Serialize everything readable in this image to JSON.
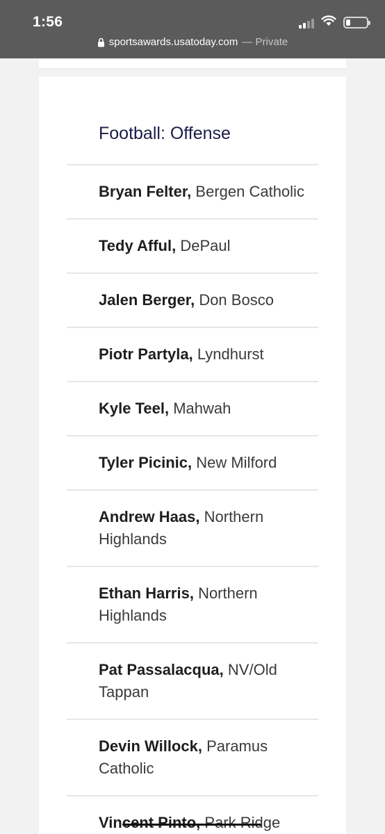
{
  "status_bar": {
    "time": "1:56"
  },
  "url_bar": {
    "domain": "sportsawards.usatoday.com",
    "suffix": "— Private"
  },
  "section": {
    "title": "Football: Offense"
  },
  "players": [
    {
      "name": "Bryan Felter,",
      "school": "Bergen Catholic"
    },
    {
      "name": "Tedy Afful,",
      "school": "DePaul"
    },
    {
      "name": "Jalen Berger,",
      "school": "Don Bosco"
    },
    {
      "name": "Piotr Partyla,",
      "school": "Lyndhurst"
    },
    {
      "name": "Kyle Teel,",
      "school": "Mahwah"
    },
    {
      "name": "Tyler Picinic,",
      "school": "New Milford"
    },
    {
      "name": "Andrew Haas,",
      "school": "Northern Highlands"
    },
    {
      "name": "Ethan Harris,",
      "school": "Northern Highlands"
    },
    {
      "name": "Pat Passalacqua,",
      "school": "NV/Old Tappan"
    },
    {
      "name": "Devin Willock,",
      "school": "Paramus Catholic"
    },
    {
      "name": "Vincent Pinto,",
      "school": "Park Ridge"
    }
  ],
  "colors": {
    "title": "#1c1b48",
    "topbar": "#5b5b5b",
    "divider": "#e6e6e6"
  }
}
